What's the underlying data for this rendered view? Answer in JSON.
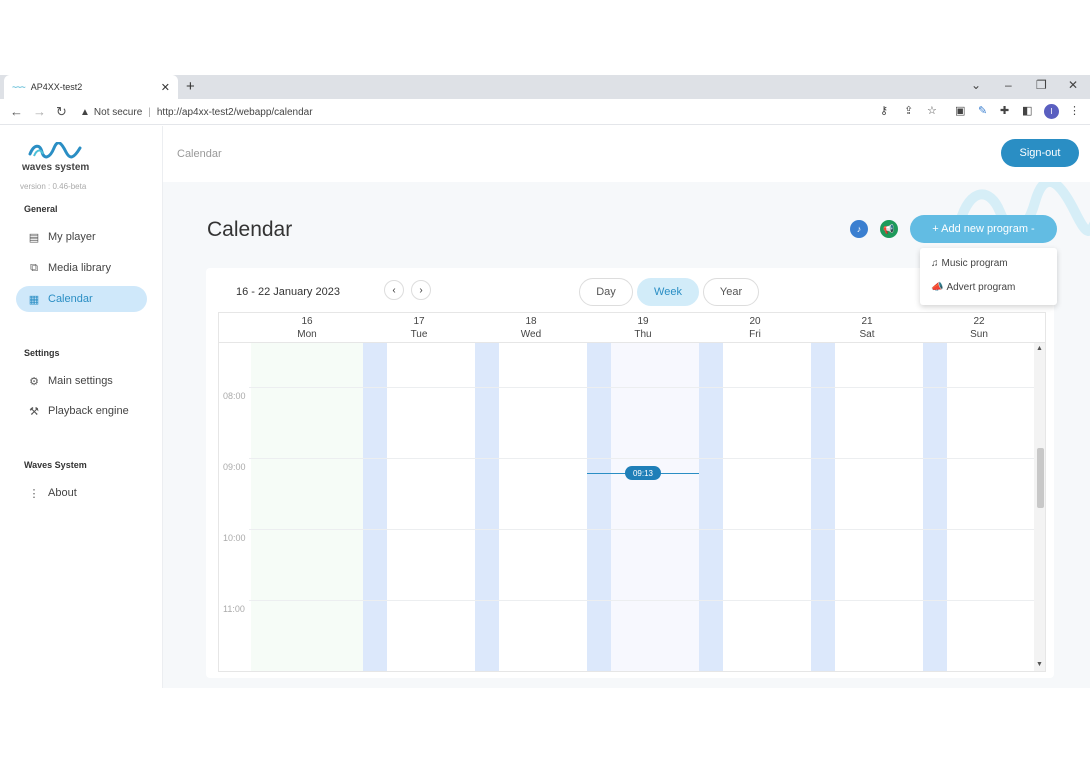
{
  "browser": {
    "tab_title": "AP4XX-test2",
    "tab_favicon": "~~~",
    "url": "http://ap4xx-test2/webapp/calendar",
    "security": "Not secure",
    "profile_initial": "I"
  },
  "sidebar": {
    "logo_text": "waves system",
    "version": "version : 0.46-beta",
    "sections": {
      "general": "General",
      "settings": "Settings",
      "waves": "Waves System"
    },
    "items": {
      "my_player": "My player",
      "media_library": "Media library",
      "calendar": "Calendar",
      "main_settings": "Main settings",
      "playback_engine": "Playback engine",
      "about": "About"
    }
  },
  "topbar": {
    "breadcrumb": "Calendar",
    "signout": "Sign-out"
  },
  "main": {
    "title": "Calendar",
    "add_program": "+ Add new program -",
    "menu": {
      "music": "Music program",
      "advert": "Advert program"
    },
    "date_range": "16 - 22 January 2023",
    "views": {
      "day": "Day",
      "week": "Week",
      "year": "Year"
    }
  },
  "calendar": {
    "days": [
      {
        "num": "16",
        "name": "Mon"
      },
      {
        "num": "17",
        "name": "Tue"
      },
      {
        "num": "18",
        "name": "Wed"
      },
      {
        "num": "19",
        "name": "Thu"
      },
      {
        "num": "20",
        "name": "Fri"
      },
      {
        "num": "21",
        "name": "Sat"
      },
      {
        "num": "22",
        "name": "Sun"
      }
    ],
    "hours": [
      "08:00",
      "09:00",
      "10:00",
      "11:00"
    ],
    "now": "09:13"
  },
  "colors": {
    "accent": "#2a8ec4",
    "accent_light": "#62bce3",
    "active_nav": "#cfe8fa",
    "today_bg": "#f6fcf7",
    "music_btn": "#3a7fd0",
    "advert_btn": "#1e9a5a"
  }
}
